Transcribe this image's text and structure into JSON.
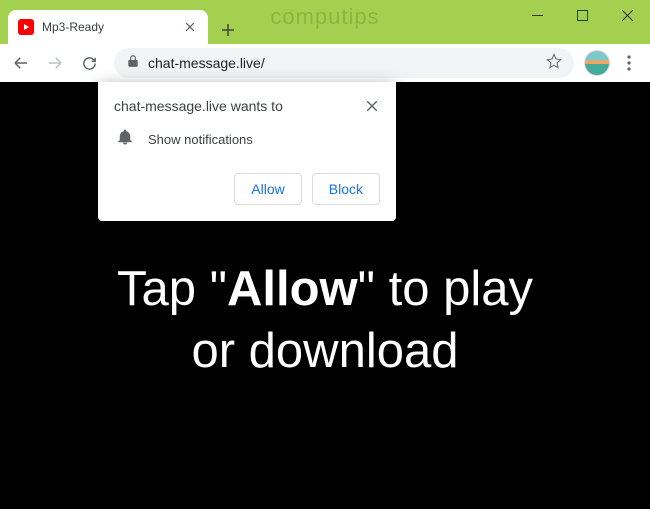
{
  "window": {
    "branding": "computips"
  },
  "tab": {
    "title": "Mp3-Ready"
  },
  "toolbar": {
    "url": "chat-message.live/"
  },
  "permission": {
    "origin_wants_to": "chat-message.live wants to",
    "capability": "Show notifications",
    "allow": "Allow",
    "block": "Block"
  },
  "page": {
    "line1_pre": "Tap \"",
    "line1_bold": "Allow",
    "line1_post": "\" to play",
    "line2": "or download"
  }
}
